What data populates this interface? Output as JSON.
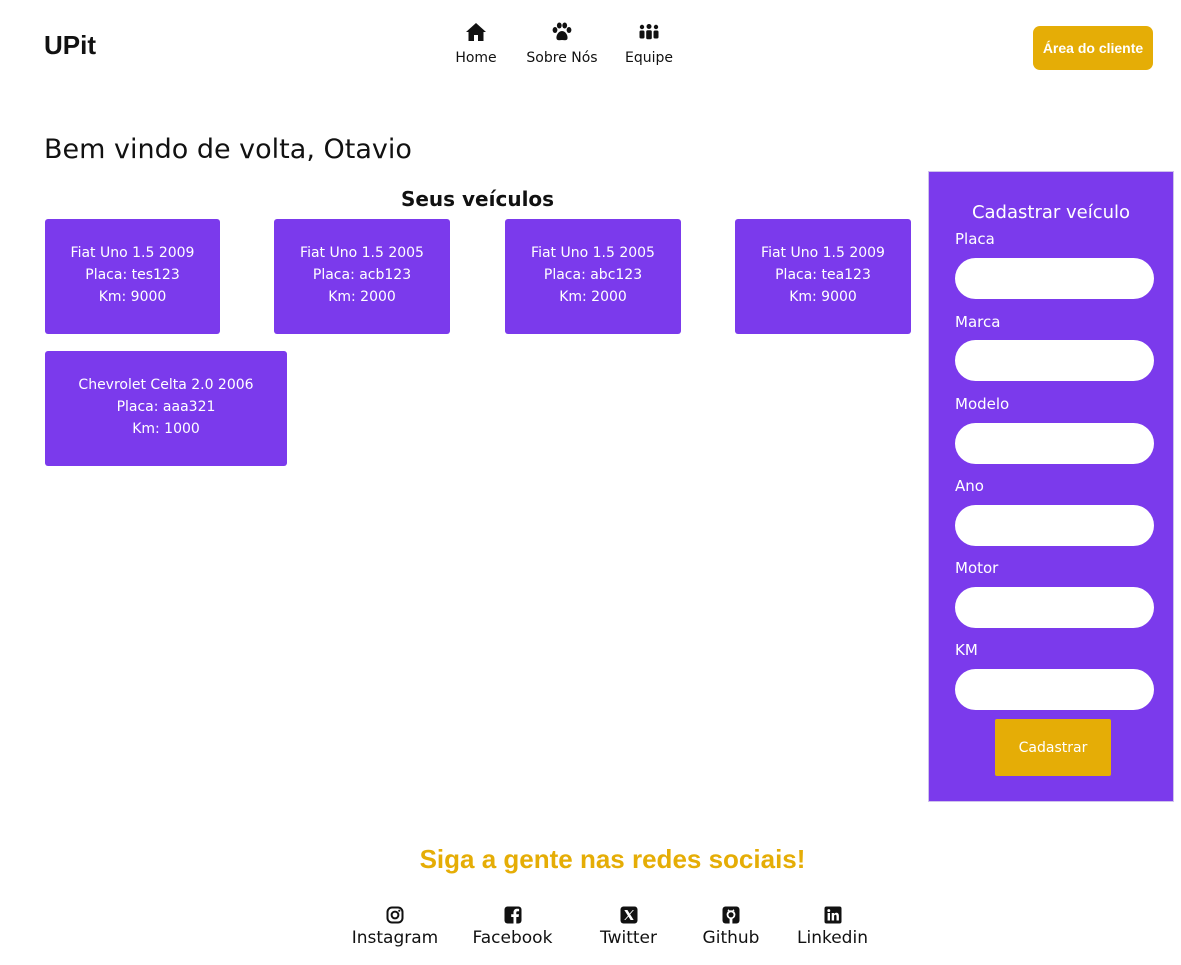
{
  "header": {
    "logo": "UPit",
    "nav": [
      {
        "label": "Home",
        "icon": "home-icon"
      },
      {
        "label": "Sobre Nós",
        "icon": "paw-icon"
      },
      {
        "label": "Equipe",
        "icon": "people-icon"
      }
    ],
    "client_button": "Área do cliente"
  },
  "main": {
    "welcome": "Bem vindo de volta, Otavio",
    "vehicles_title": "Seus veículos",
    "vehicles": [
      {
        "name": "Fiat Uno 1.5 2009",
        "plate": "Placa: tes123",
        "km": "Km: 9000"
      },
      {
        "name": "Fiat Uno 1.5 2005",
        "plate": "Placa: acb123",
        "km": "Km: 2000"
      },
      {
        "name": "Fiat Uno 1.5 2005",
        "plate": "Placa: abc123",
        "km": "Km: 2000"
      },
      {
        "name": "Fiat Uno 1.5 2009",
        "plate": "Placa: tea123",
        "km": "Km: 9000"
      },
      {
        "name": "Chevrolet Celta 2.0 2006",
        "plate": "Placa: aaa321",
        "km": "Km: 1000"
      }
    ]
  },
  "form": {
    "title": "Cadastrar veículo",
    "fields": [
      {
        "label": "Placa",
        "value": ""
      },
      {
        "label": "Marca",
        "value": ""
      },
      {
        "label": "Modelo",
        "value": ""
      },
      {
        "label": "Ano",
        "value": ""
      },
      {
        "label": "Motor",
        "value": ""
      },
      {
        "label": "KM",
        "value": ""
      }
    ],
    "submit": "Cadastrar"
  },
  "footer": {
    "title": "Siga a gente nas redes sociais!",
    "social": [
      {
        "label": "Instagram",
        "icon": "instagram-icon"
      },
      {
        "label": "Facebook",
        "icon": "facebook-icon"
      },
      {
        "label": "Twitter",
        "icon": "x-twitter-icon"
      },
      {
        "label": "Github",
        "icon": "github-icon"
      },
      {
        "label": "Linkedin",
        "icon": "linkedin-icon"
      }
    ]
  },
  "colors": {
    "purple": "#7b3aec",
    "gold": "#e5ad06"
  }
}
